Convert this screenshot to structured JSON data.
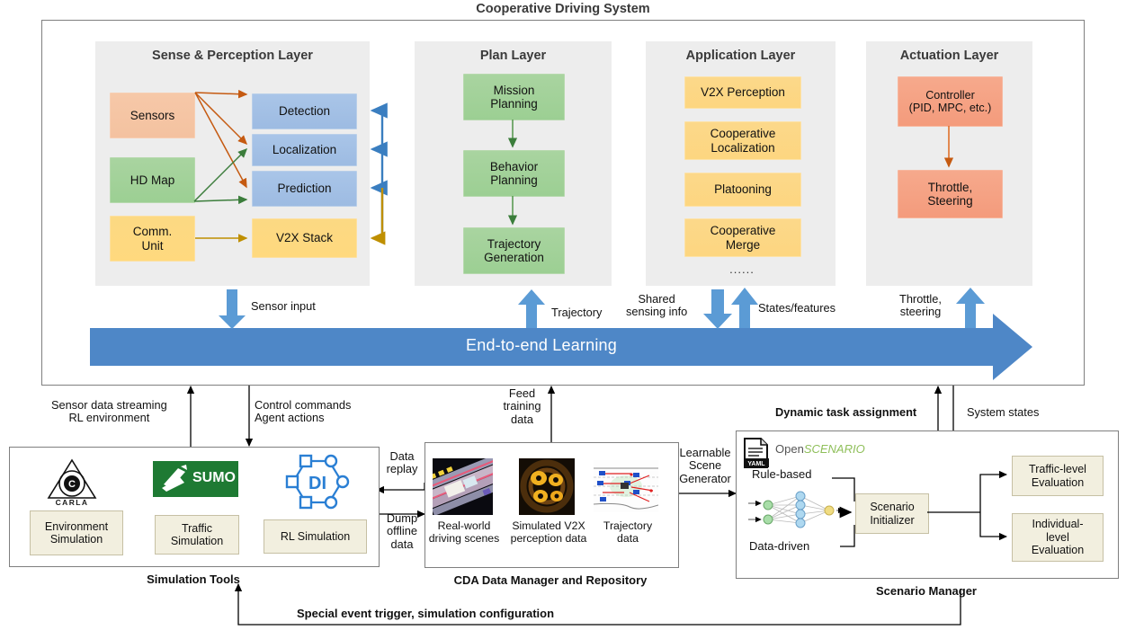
{
  "title": "Cooperative Driving System",
  "layers": [
    {
      "id": "sense",
      "title": "Sense & Perception Layer",
      "nodes": [
        {
          "name": "sensors",
          "label": "Sensors"
        },
        {
          "name": "hd-map",
          "label": "HD Map"
        },
        {
          "name": "comm-unit",
          "label": "Comm.\nUnit"
        },
        {
          "name": "detection",
          "label": "Detection"
        },
        {
          "name": "localization",
          "label": "Localization"
        },
        {
          "name": "prediction",
          "label": "Prediction"
        },
        {
          "name": "v2x-stack",
          "label": "V2X Stack"
        }
      ]
    },
    {
      "id": "plan",
      "title": "Plan Layer",
      "nodes": [
        {
          "name": "mission-planning",
          "label": "Mission\nPlanning"
        },
        {
          "name": "behavior-planning",
          "label": "Behavior\nPlanning"
        },
        {
          "name": "trajectory-generation",
          "label": "Trajectory\nGeneration"
        }
      ]
    },
    {
      "id": "application",
      "title": "Application Layer",
      "nodes": [
        {
          "name": "v2x-perception",
          "label": "V2X Perception"
        },
        {
          "name": "cooperative-localization",
          "label": "Cooperative\nLocalization"
        },
        {
          "name": "platooning",
          "label": "Platooning"
        },
        {
          "name": "cooperative-merge",
          "label": "Cooperative\nMerge"
        }
      ],
      "ellipsis": "......"
    },
    {
      "id": "actuation",
      "title": "Actuation Layer",
      "nodes": [
        {
          "name": "controller",
          "label": "Controller\n(PID, MPC, etc.)"
        },
        {
          "name": "throttle-steering",
          "label": "Throttle,\nSteering"
        }
      ]
    }
  ],
  "e2e": {
    "label": "End-to-end Learning"
  },
  "flow_labels": {
    "sensor_input": "Sensor input",
    "trajectory": "Trajectory",
    "shared_sensing_info": "Shared\nsensing info",
    "states_features": "States/features",
    "throttle_steering": "Throttle,\nsteering",
    "sensor_data_streaming": "Sensor data streaming\nRL environment",
    "control_commands": "Control commands\nAgent actions",
    "feed_training_data": "Feed\ntraining\ndata",
    "dynamic_task_assignment": "Dynamic task assignment",
    "system_states": "System states",
    "data_replay": "Data\nreplay",
    "dump_offline_data": "Dump\noffline\ndata",
    "learnable_scene_generator": "Learnable\nScene\nGenerator",
    "special_event_trigger": "Special event trigger, simulation configuration"
  },
  "simulation_tools": {
    "caption": "Simulation Tools",
    "logos": [
      {
        "name": "carla-logo",
        "text": "CARLA"
      },
      {
        "name": "sumo-logo",
        "text": "SUMO"
      },
      {
        "name": "di-logo",
        "text": "DI"
      }
    ],
    "boxes": [
      {
        "name": "environment-simulation",
        "label": "Environment\nSimulation"
      },
      {
        "name": "traffic-simulation",
        "label": "Traffic\nSimulation"
      },
      {
        "name": "rl-simulation",
        "label": "RL Simulation"
      }
    ]
  },
  "cda_repository": {
    "caption": "CDA Data Manager and Repository",
    "items": [
      {
        "name": "real-world-driving-scenes",
        "label": "Real-world\ndriving scenes"
      },
      {
        "name": "simulated-v2x-perception-data",
        "label": "Simulated V2X\nperception data"
      },
      {
        "name": "trajectory-data",
        "label": "Trajectory\ndata"
      }
    ]
  },
  "scenario_manager": {
    "caption": "Scenario Manager",
    "openscenario": {
      "prefix": "Open",
      "suffix": "SCENARIO",
      "file_icon_label": "YAML"
    },
    "sources": [
      {
        "name": "rule-based",
        "label": "Rule-based"
      },
      {
        "name": "data-driven",
        "label": "Data-driven"
      }
    ],
    "initializer": {
      "name": "scenario-initializer",
      "label": "Scenario\nInitializer"
    },
    "evaluations": [
      {
        "name": "traffic-level-evaluation",
        "label": "Traffic-level\nEvaluation"
      },
      {
        "name": "individual-level-evaluation",
        "label": "Individual-\nlevel\nEvaluation"
      }
    ]
  },
  "colors": {
    "blue": "#4e87c7",
    "e2e_band": "#4e87c7",
    "orange_arrow": "#c55a11",
    "green_arrow": "#3b7d3b",
    "gold_arrow": "#bf8f00",
    "panel_border": "#7f7f7f",
    "layer_bg": "#ededed"
  }
}
